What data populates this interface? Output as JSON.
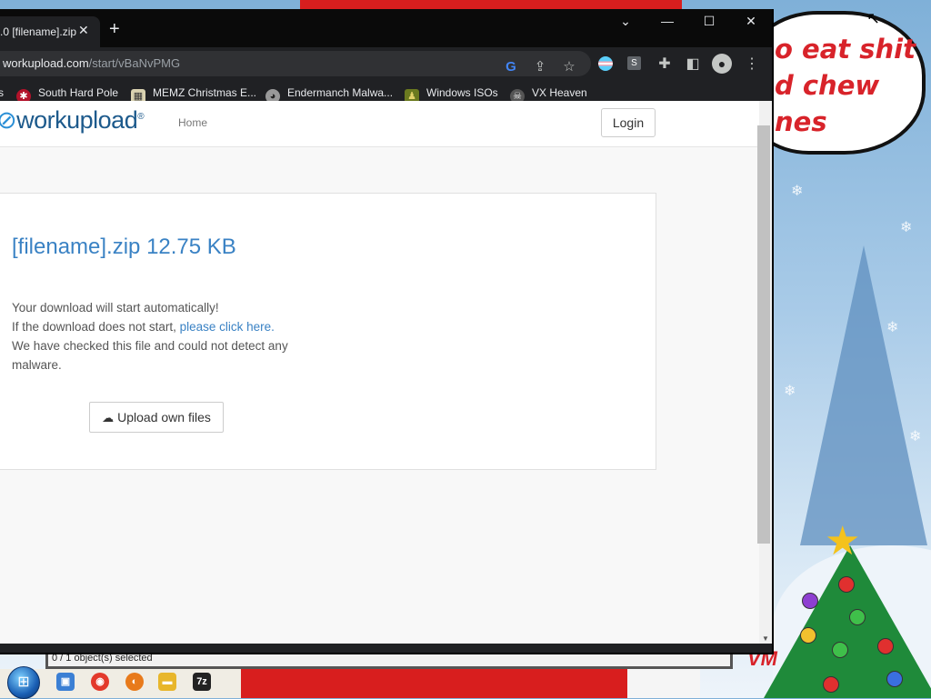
{
  "desktop": {
    "bubble_text": "o eat shit\nd chew\nnes",
    "vm_text": "VM"
  },
  "browser": {
    "tab_title": ".0 [filename].zip",
    "tab_close": "✕",
    "new_tab": "+",
    "window_controls": {
      "tab_search": "⌄",
      "minimize": "—",
      "maximize": "☐",
      "close": "✕"
    },
    "url_host": "workupload.com",
    "url_path": "/start/vBaNvPMG",
    "bookmarks": [
      {
        "label": "South Hard Pole",
        "icon": "snowflake-icon"
      },
      {
        "label": "MEMZ Christmas E...",
        "icon": "image-icon"
      },
      {
        "label": "Endermanch Malwa...",
        "icon": "cat-icon"
      },
      {
        "label": "Windows ISOs",
        "icon": "figure-icon"
      },
      {
        "label": "VX Heaven",
        "icon": "skull-icon"
      }
    ],
    "bookmarks_overflow": "s"
  },
  "page": {
    "nav_home": "Home",
    "login_label": "Login",
    "file_title": "[filename].zip 12.75 KB",
    "auto_download": "Your download will start automatically!",
    "not_start_prefix": "If the download does not start, ",
    "click_here": "please click here.",
    "malware_check": "We have checked this file and could not detect any malware.",
    "upload_label": "Upload own files"
  },
  "explorer": {
    "status": "0 / 1 object(s) selected"
  },
  "colors": {
    "link_blue": "#3a82c4",
    "chrome_dark": "#202124",
    "bubble_red": "#d8232a"
  }
}
